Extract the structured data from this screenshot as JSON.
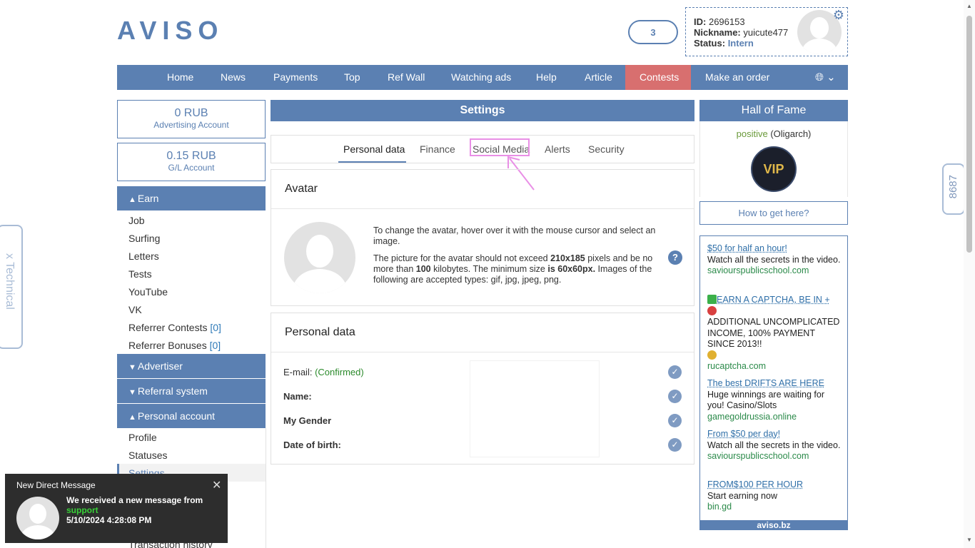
{
  "header": {
    "logo": "AVISO",
    "notif_count": "3",
    "user": {
      "id_label": "ID:",
      "id_value": "2696153",
      "nick_label": "Nickname:",
      "nick_value": "yuicute477",
      "status_label": "Status:",
      "status_value": "Intern"
    }
  },
  "nav": {
    "items": [
      "Home",
      "News",
      "Payments",
      "Top",
      "Ref Wall",
      "Watching ads",
      "Help",
      "Article",
      "Contests",
      "Make an order"
    ],
    "language_icon": "globe-icon"
  },
  "left": {
    "advertising": {
      "amount": "0 RUB",
      "label": "Advertising Account"
    },
    "gl": {
      "amount": "0.15 RUB",
      "label": "G/L Account"
    },
    "earn": {
      "title": "Earn",
      "items": [
        "Job",
        "Surfing",
        "Letters",
        "Tests",
        "YouTube",
        "VK",
        "Referrer Contests",
        "Referrer Bonuses"
      ],
      "referrer_contests_count": "[0]",
      "referrer_bonuses_count": "[0]"
    },
    "advertiser": "Advertiser",
    "referral": "Referral system",
    "personal": {
      "title": "Personal account",
      "items": [
        "Profile",
        "Statuses",
        "Settings",
        "Transaction history"
      ]
    }
  },
  "settings": {
    "title": "Settings",
    "tabs": [
      "Personal data",
      "Finance",
      "Social Media",
      "Alerts",
      "Security"
    ],
    "avatar_panel": {
      "title": "Avatar",
      "p1": "To change the avatar, hover over it with the mouse cursor and select an image.",
      "p2_a": "The picture for the avatar should not exceed ",
      "p2_b": "210x185",
      "p2_c": " pixels and be no more than ",
      "p2_d": "100",
      "p2_e": " kilobytes. The minimum size ",
      "p2_f": "is 60x60px.",
      "p2_g": " Images of the following are accepted types: gif, jpg, jpeg, png.",
      "help": "?"
    },
    "personal_panel": {
      "title": "Personal data",
      "email_label": "E-mail:",
      "email_status": "(Confirmed)",
      "name_label": "Name:",
      "gender_label": "My Gender",
      "dob_label": "Date of birth:"
    }
  },
  "right": {
    "hof_title": "Hall of Fame",
    "hof_name": "positive",
    "hof_rank": "(Oligarch)",
    "vip_badge": "VIP",
    "howto": "How to get here?",
    "ads": [
      {
        "title": "$50 for half an hour!",
        "desc": "Watch all the secrets in the video.",
        "domain": "saviourspublicschool.com"
      },
      {
        "title": "EARN A CAPTCHA, BE IN +",
        "desc": "ADDITIONAL UNCOMPLICATED INCOME, 100% PAYMENT SINCE 2013!!",
        "domain": "rucaptcha.com"
      },
      {
        "title": "The best DRIFTS ARE HERE",
        "desc": "Huge winnings are waiting for you! Casino/Slots",
        "domain": "gamegoldrussia.online"
      },
      {
        "title": "From $50 per day!",
        "desc": "Watch all the secrets in the video.",
        "domain": "saviourspublicschool.com"
      },
      {
        "title": "FROM$100 PER HOUR",
        "desc": "Start earning now",
        "domain": "bin.gd"
      }
    ],
    "footer": "aviso.bz"
  },
  "side": {
    "left_label": "x Technical",
    "right_label": "8687"
  },
  "toast": {
    "title": "New Direct Message",
    "line1": "We received a new message from",
    "sender": "support",
    "time": "5/10/2024 4:28:08 PM"
  },
  "colors": {
    "brand": "#5b80b2",
    "contests": "#d86f6f",
    "toast_bg": "#2d2d2d",
    "highlight": "#e98fe6"
  }
}
